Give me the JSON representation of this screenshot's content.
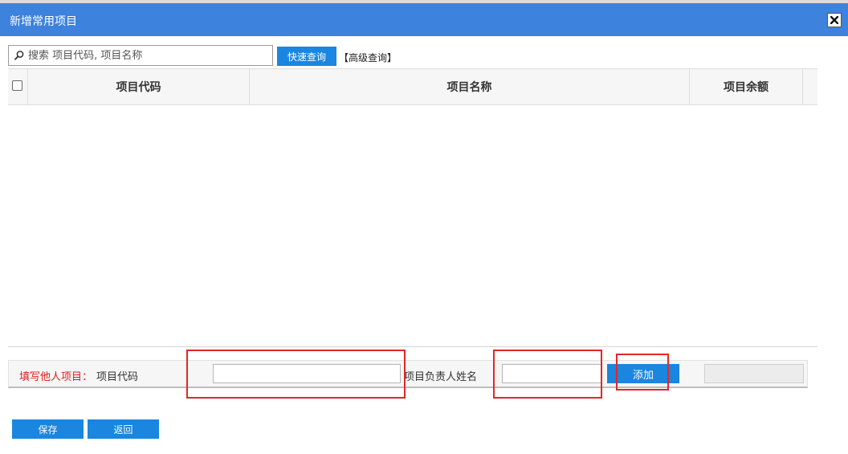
{
  "dialog": {
    "title": "新增常用项目",
    "close_icon": "close-icon"
  },
  "search": {
    "placeholder": "搜索 项目代码, 项目名称",
    "quick_button": "快速查询",
    "advanced_link": "【高级查询】"
  },
  "grid": {
    "columns": [
      "项目代码",
      "项目名称",
      "项目余额"
    ],
    "rows": []
  },
  "add_other": {
    "label": "填写他人项目：",
    "code_label": "项目代码",
    "code_value": "",
    "owner_label": "项目负责人姓名",
    "owner_value": "",
    "add_button": "添加"
  },
  "footer": {
    "save_button": "保存",
    "back_button": "返回"
  },
  "colors": {
    "header_bg": "#3d82dc",
    "button_bg": "#1a86e0",
    "label_red": "#e21b1b",
    "annotation_red": "#e32626"
  }
}
